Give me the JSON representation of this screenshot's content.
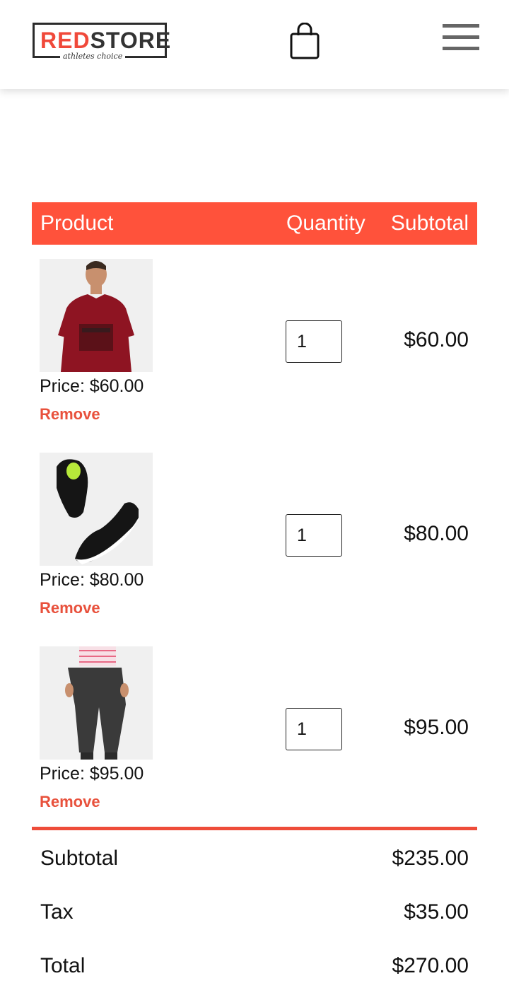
{
  "header": {
    "logo_red": "RED",
    "logo_dark": "STORE",
    "logo_tagline": "athletes choice",
    "cart_icon": "shopping-bag-icon",
    "menu_icon": "hamburger-menu-icon"
  },
  "table": {
    "col_product": "Product",
    "col_quantity": "Quantity",
    "col_subtotal": "Subtotal"
  },
  "items": [
    {
      "image": "red-tshirt-model",
      "price": "Price: $60.00",
      "remove": "Remove",
      "quantity": "1",
      "subtotal": "$60.00"
    },
    {
      "image": "black-sneakers",
      "price": "Price: $80.00",
      "remove": "Remove",
      "quantity": "1",
      "subtotal": "$80.00"
    },
    {
      "image": "grey-joggers-model",
      "price": "Price: $95.00",
      "remove": "Remove",
      "quantity": "1",
      "subtotal": "$95.00"
    }
  ],
  "totals": {
    "subtotal_label": "Subtotal",
    "subtotal_value": "$235.00",
    "tax_label": "Tax",
    "tax_value": "$35.00",
    "total_label": "Total",
    "total_value": "$270.00"
  },
  "colors": {
    "accent": "#ff523b",
    "remove_text": "#e8513c"
  }
}
